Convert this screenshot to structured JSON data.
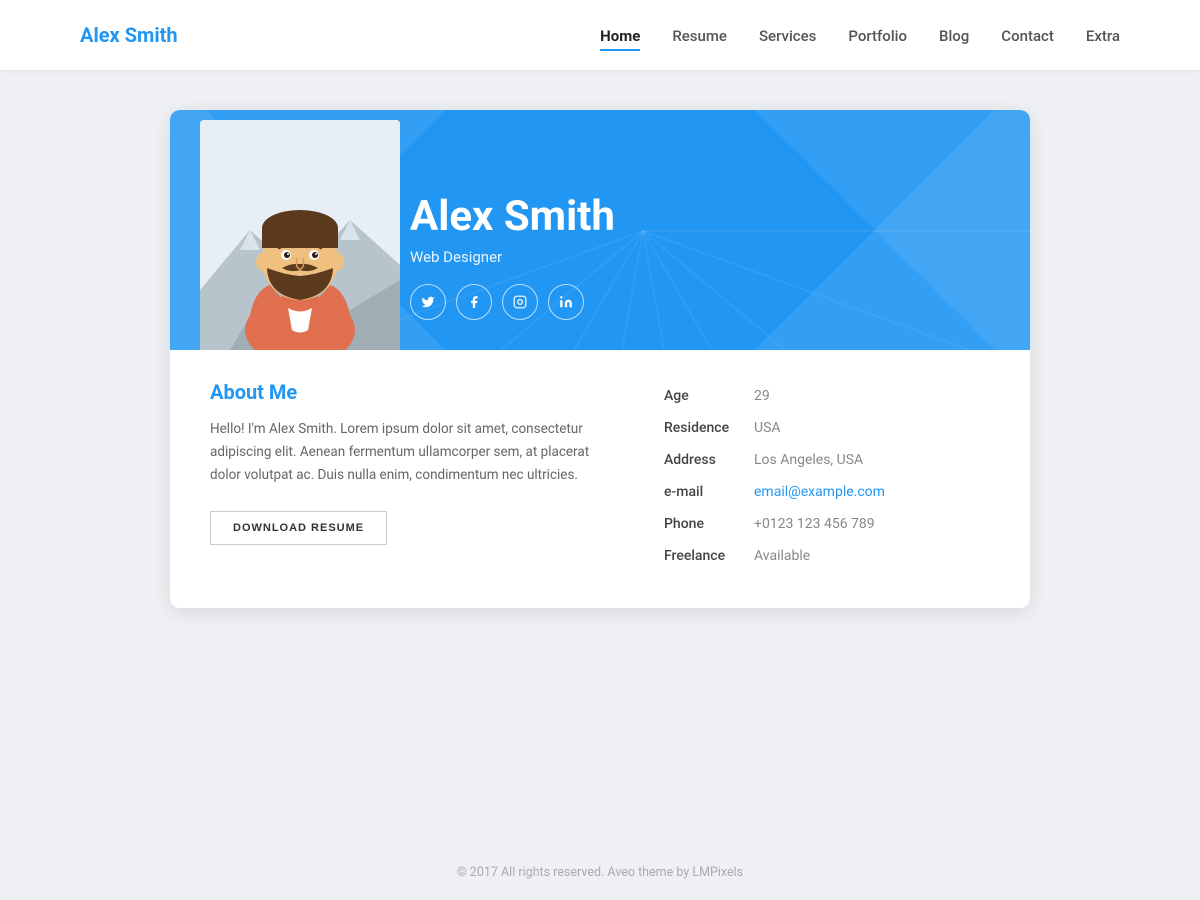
{
  "nav": {
    "logo_black": "Alex ",
    "logo_blue": "Smith",
    "links": [
      {
        "label": "Home",
        "active": true
      },
      {
        "label": "Resume",
        "active": false
      },
      {
        "label": "Services",
        "active": false
      },
      {
        "label": "Portfolio",
        "active": false
      },
      {
        "label": "Blog",
        "active": false
      },
      {
        "label": "Contact",
        "active": false
      },
      {
        "label": "Extra",
        "active": false
      }
    ]
  },
  "hero": {
    "name": "Alex Smith",
    "title": "Web Designer",
    "social": [
      {
        "icon": "𝕏",
        "label": "twitter-icon",
        "char": "t"
      },
      {
        "icon": "f",
        "label": "facebook-icon",
        "char": "f"
      },
      {
        "icon": "◻",
        "label": "instagram-icon",
        "char": "in"
      },
      {
        "icon": "in",
        "label": "linkedin-icon",
        "char": "li"
      }
    ]
  },
  "about": {
    "heading_black": "About ",
    "heading_blue": "Me",
    "bio": "Hello! I'm Alex Smith. Lorem ipsum dolor sit amet, consectetur adipiscing elit. Aenean fermentum ullamcorper sem, at placerat dolor volutpat ac. Duis nulla enim, condimentum nec ultricies.",
    "download_btn": "DOWNLOAD RESUME"
  },
  "info": {
    "rows": [
      {
        "label": "Age",
        "value": "29",
        "is_email": false
      },
      {
        "label": "Residence",
        "value": "USA",
        "is_email": false
      },
      {
        "label": "Address",
        "value": "Los Angeles, USA",
        "is_email": false
      },
      {
        "label": "e-mail",
        "value": "email@example.com",
        "is_email": true
      },
      {
        "label": "Phone",
        "value": "+0123 123 456 789",
        "is_email": false
      },
      {
        "label": "Freelance",
        "value": "Available",
        "is_email": false
      }
    ]
  },
  "footer": {
    "text": "© 2017 All rights reserved. Aveo theme by LMPixels"
  },
  "colors": {
    "blue": "#2196f3",
    "dark": "#222",
    "muted": "#888"
  }
}
